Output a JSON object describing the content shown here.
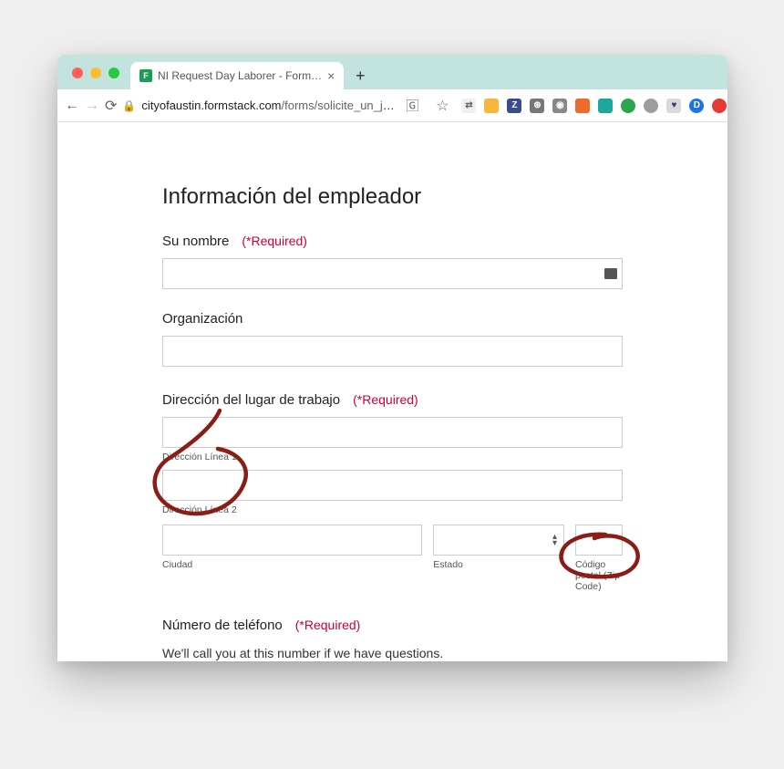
{
  "browser": {
    "tab_title": "NI Request Day Laborer - Form…",
    "url_domain": "cityofaustin.formstack.com",
    "url_path": "/forms/solicite_un_jornal…",
    "new_tab_glyph": "+",
    "close_tab_glyph": "×",
    "back_glyph": "←",
    "forward_glyph": "→",
    "reload_glyph": "⟳",
    "star_glyph": "☆"
  },
  "ext_icons": [
    {
      "name": "translate-icon",
      "bg": "#f0f0f0",
      "txt": "",
      "fg": "#666",
      "glyph": "⇄"
    },
    {
      "name": "ext-yellow",
      "bg": "#f6b73c",
      "txt": ""
    },
    {
      "name": "ext-z",
      "bg": "#3b4b8f",
      "txt": "Z"
    },
    {
      "name": "ext-globe",
      "bg": "#777",
      "txt": "",
      "glyph": "⊛",
      "fg": "#fff"
    },
    {
      "name": "ext-camera",
      "bg": "#888",
      "txt": "",
      "glyph": "◉",
      "fg": "#fff"
    },
    {
      "name": "ext-orange",
      "bg": "#f06a2b",
      "txt": ""
    },
    {
      "name": "ext-teal",
      "bg": "#1aa89c",
      "txt": ""
    },
    {
      "name": "ext-green",
      "bg": "#2da44e",
      "txt": "",
      "round": true
    },
    {
      "name": "ext-gray",
      "bg": "#9e9e9e",
      "txt": "",
      "round": true
    },
    {
      "name": "ext-heart",
      "bg": "#d9d9d9",
      "txt": "",
      "glyph": "♥",
      "fg": "#3b3b6b"
    },
    {
      "name": "profile-d",
      "bg": "#1a73e8",
      "txt": "D",
      "round": true
    },
    {
      "name": "ext-red",
      "bg": "#e53935",
      "txt": "",
      "round": true
    }
  ],
  "form": {
    "heading": "Información del empleador",
    "required_label": "(*Required)",
    "name_label": "Su nombre",
    "org_label": "Organización",
    "addr_label": "Dirección del lugar de trabajo",
    "addr_line1": "Dirección Línea 1",
    "addr_line2": "Dirección Línea 2",
    "city_label": "Ciudad",
    "state_label": "Estado",
    "zip_label": "Código postal (Zip Code)",
    "phone_label": "Número de teléfono",
    "phone_helper": "We'll call you at this number if we have questions."
  }
}
